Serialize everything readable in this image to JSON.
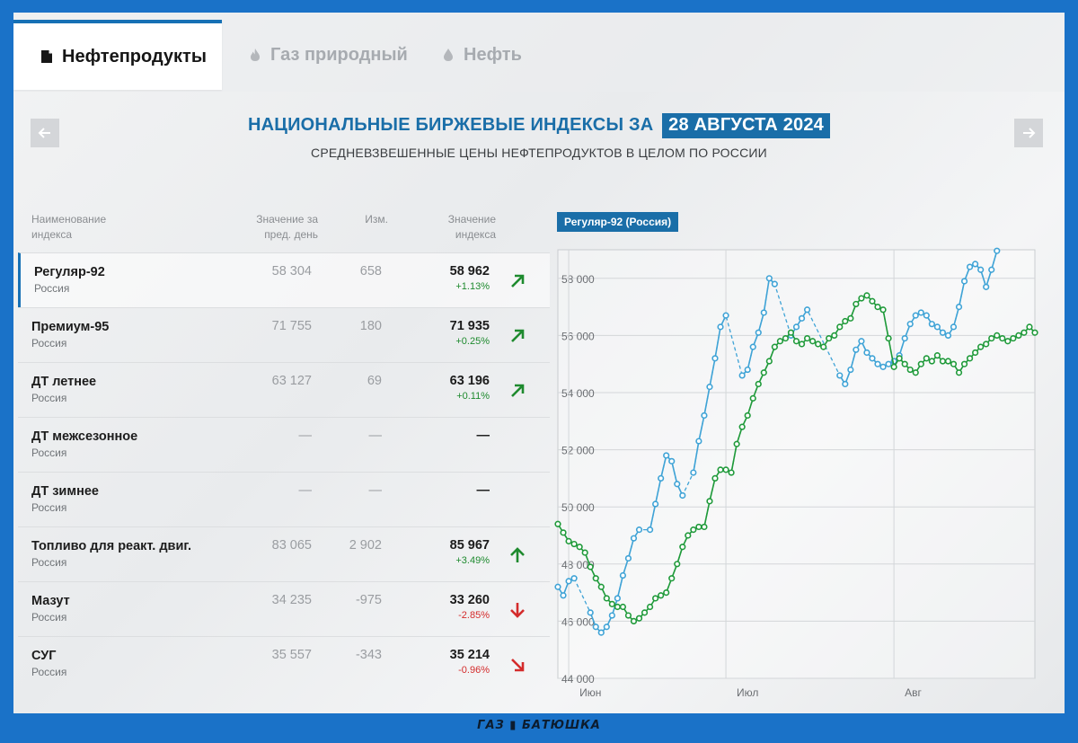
{
  "tabs": [
    {
      "label": "Нефтепродукты",
      "icon": "document-icon",
      "active": true
    },
    {
      "label": "Газ природный",
      "icon": "flame-icon",
      "active": false
    },
    {
      "label": "Нефть",
      "icon": "drop-icon",
      "active": false
    }
  ],
  "header": {
    "title": "НАЦИОНАЛЬНЫЕ БИРЖЕВЫЕ ИНДЕКСЫ ЗА",
    "date": "28 АВГУСТА 2024",
    "subtitle": "СРЕДНЕВЗВЕШЕННЫЕ ЦЕНЫ НЕФТЕПРОДУКТОВ В ЦЕЛОМ ПО РОССИИ"
  },
  "table": {
    "headers": {
      "name": [
        "Наименование",
        "индекса"
      ],
      "prev": [
        "Значение за",
        "пред. день"
      ],
      "chg": [
        "Изм."
      ],
      "val": [
        "Значение",
        "индекса"
      ]
    },
    "rows": [
      {
        "name": "Регуляр-92",
        "region": "Россия",
        "prev": "58 304",
        "chg": "658",
        "val": "58 962",
        "pct": "+1.13%",
        "dir": "up-right"
      },
      {
        "name": "Премиум-95",
        "region": "Россия",
        "prev": "71 755",
        "chg": "180",
        "val": "71 935",
        "pct": "+0.25%",
        "dir": "up-right"
      },
      {
        "name": "ДТ летнее",
        "region": "Россия",
        "prev": "63 127",
        "chg": "69",
        "val": "63 196",
        "pct": "+0.11%",
        "dir": "up-right"
      },
      {
        "name": "ДТ межсезонное",
        "region": "Россия",
        "prev": "—",
        "chg": "—",
        "val": "—",
        "pct": "",
        "dir": "none"
      },
      {
        "name": "ДТ зимнее",
        "region": "Россия",
        "prev": "—",
        "chg": "—",
        "val": "—",
        "pct": "",
        "dir": "none"
      },
      {
        "name": "Топливо для реакт. двиг.",
        "region": "Россия",
        "prev": "83 065",
        "chg": "2 902",
        "val": "85 967",
        "pct": "+3.49%",
        "dir": "up"
      },
      {
        "name": "Мазут",
        "region": "Россия",
        "prev": "34 235",
        "chg": "-975",
        "val": "33 260",
        "pct": "-2.85%",
        "dir": "down"
      },
      {
        "name": "СУГ",
        "region": "Россия",
        "prev": "35 557",
        "chg": "-343",
        "val": "35 214",
        "pct": "-0.96%",
        "dir": "down-right"
      }
    ]
  },
  "chart_label": "Регуляр-92 (Россия)",
  "colors": {
    "accent": "#1a6ea8",
    "up": "#1e8a2e",
    "down": "#d42b2b",
    "series_blue": "#3fa3d6",
    "series_green": "#1f9a3a",
    "background": "#1a72c8"
  },
  "chart_data": {
    "type": "line",
    "ylim": [
      44000,
      59000
    ],
    "yticks": [
      44000,
      46000,
      48000,
      50000,
      52000,
      54000,
      56000,
      58000
    ],
    "ytick_labels": [
      "44 000",
      "46 000",
      "48 000",
      "50 000",
      "52 000",
      "54 000",
      "56 000",
      "58 000"
    ],
    "xlim": [
      0,
      88
    ],
    "xticks": [
      {
        "x": 2,
        "label": "Июн"
      },
      {
        "x": 31,
        "label": "Июл"
      },
      {
        "x": 62,
        "label": "Авг"
      }
    ],
    "grid": true,
    "series": [
      {
        "color": "#3fa3d6",
        "values": [
          47200,
          46900,
          47400,
          47500,
          null,
          null,
          46300,
          45800,
          45600,
          45800,
          46200,
          46800,
          47600,
          48200,
          48900,
          49200,
          null,
          49200,
          50100,
          51000,
          51800,
          51600,
          50800,
          50400,
          null,
          51200,
          52300,
          53200,
          54200,
          55200,
          56300,
          56700,
          null,
          null,
          54600,
          54800,
          55600,
          56100,
          56800,
          58000,
          57800,
          null,
          null,
          56000,
          56300,
          56600,
          56900,
          null,
          null,
          null,
          null,
          null,
          54600,
          54300,
          54800,
          55500,
          55800,
          55400,
          55200,
          55000,
          54900,
          55000,
          55100,
          55300,
          55900,
          56400,
          56700,
          56800,
          56700,
          56400,
          56300,
          56100,
          56000,
          56300,
          57000,
          57900,
          58400,
          58500,
          58300,
          57700,
          58300,
          58962
        ]
      },
      {
        "color": "#1f9a3a",
        "values": [
          49400,
          49100,
          48800,
          48700,
          48600,
          48400,
          47900,
          47500,
          47200,
          46800,
          46600,
          46500,
          46500,
          46200,
          46000,
          46100,
          46300,
          46500,
          46800,
          46900,
          47000,
          47500,
          48000,
          48600,
          49000,
          49200,
          49300,
          49300,
          50200,
          51000,
          51300,
          51300,
          51200,
          52200,
          52800,
          53200,
          53800,
          54300,
          54700,
          55100,
          55600,
          55800,
          55900,
          56100,
          55800,
          55700,
          55900,
          55800,
          55700,
          55600,
          55900,
          56000,
          56300,
          56500,
          56600,
          57100,
          57300,
          57400,
          57200,
          57000,
          56900,
          55900,
          54900,
          55200,
          55000,
          54800,
          54700,
          55000,
          55200,
          55100,
          55300,
          55100,
          55100,
          55000,
          54700,
          55000,
          55200,
          55400,
          55600,
          55700,
          55900,
          56000,
          55900,
          55800,
          55900,
          56000,
          56100,
          56300,
          56100
        ]
      }
    ]
  }
}
